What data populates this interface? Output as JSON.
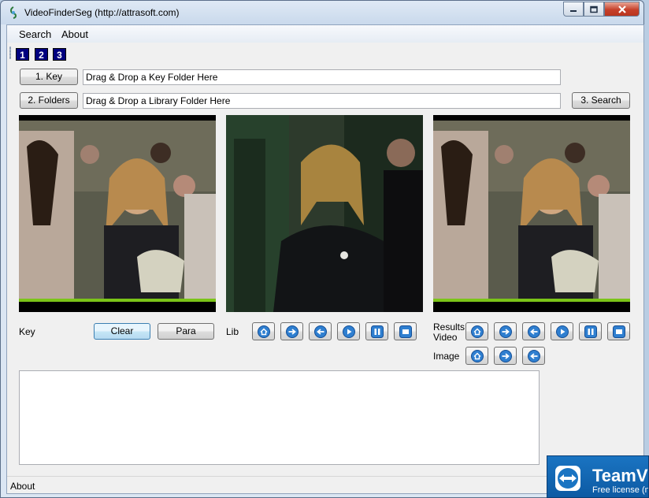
{
  "window": {
    "title": "VideoFinderSeg (http://attrasoft.com)"
  },
  "menu": {
    "items": [
      "Search",
      "About"
    ]
  },
  "toolbar": {
    "buttons": [
      "1",
      "2",
      "3"
    ]
  },
  "key_row": {
    "button": "1. Key",
    "field": "Drag & Drop a Key Folder Here"
  },
  "folders_row": {
    "button": "2. Folders",
    "field": "Drag & Drop a Library Folder Here",
    "search_button": "3. Search"
  },
  "controls": {
    "key_label": "Key",
    "clear_button": "Clear",
    "para_button": "Para",
    "lib_label": "Lib",
    "results_label": "Results",
    "video_label": "Video",
    "image_label": "Image"
  },
  "status": {
    "text": "About"
  },
  "teamviewer": {
    "title": "TeamVi",
    "subtitle": "Free license (n"
  },
  "icons": {
    "lib": [
      "home-icon",
      "next-icon",
      "previous-icon",
      "play-icon",
      "pause-icon",
      "stop-icon"
    ],
    "results_video": [
      "home-icon",
      "next-icon",
      "previous-icon",
      "play-icon",
      "pause-icon",
      "stop-icon"
    ],
    "image": [
      "home-icon",
      "next-icon",
      "previous-icon"
    ]
  },
  "colors": {
    "accent": "#00007f",
    "teamviewer": "#0e5fa8",
    "close": "#c6402a"
  }
}
